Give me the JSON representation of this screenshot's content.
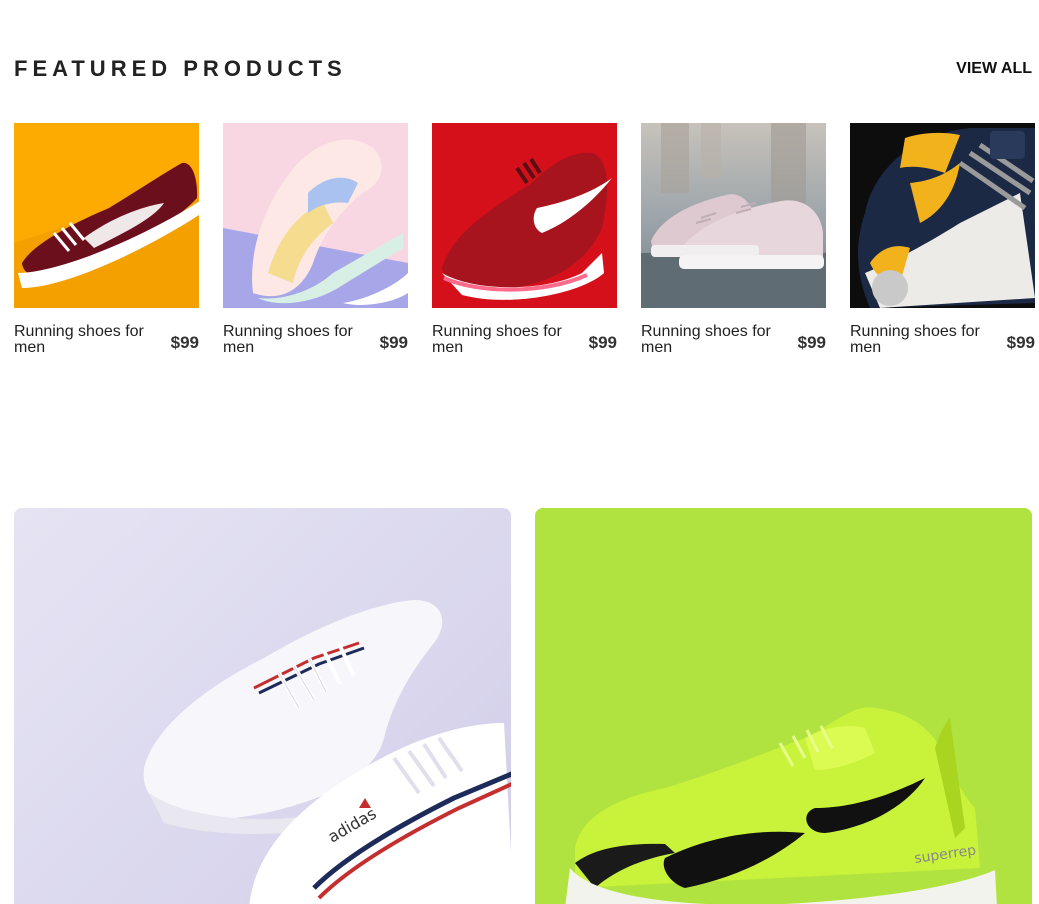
{
  "featured": {
    "title": "FEATURED PRODUCTS",
    "view_all_label": "VIEW ALL"
  },
  "products": [
    {
      "name": "Running shoes for men",
      "price": "$99",
      "image_icon": "sneaker-maroon-on-yellow-image",
      "bg": "#fdab00"
    },
    {
      "name": "Running shoes for men",
      "price": "$99",
      "image_icon": "sneaker-pastel-on-pink-image",
      "bg": "#f8d7e3"
    },
    {
      "name": "Running shoes for men",
      "price": "$99",
      "image_icon": "sneaker-red-nike-image",
      "bg": "#d5101b"
    },
    {
      "name": "Running shoes for men",
      "price": "$99",
      "image_icon": "sneaker-pink-low-top-image",
      "bg": "#a8b0b6"
    },
    {
      "name": "Running shoes for men",
      "price": "$99",
      "image_icon": "sneaker-navy-yellow-image",
      "bg": "#0d0d0d"
    }
  ],
  "banners": [
    {
      "image_icon": "white-adidas-sneakers-image",
      "bg": "#dcd9ef"
    },
    {
      "image_icon": "lime-nike-sneaker-image",
      "bg": "#b1e340"
    }
  ]
}
